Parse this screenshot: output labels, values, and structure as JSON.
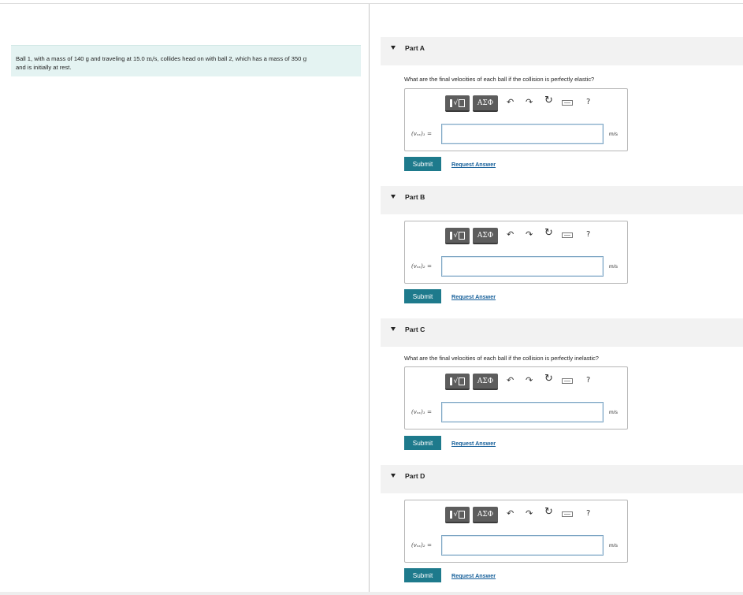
{
  "problem": {
    "text_before_speed": "Ball 1, with a mass of 140 g and traveling at 15.0 ",
    "speed_unit": "m/s",
    "text_after_speed": ", collides head on with ball 2, which has a mass of 350 ",
    "mass_unit": "g",
    "text_line2": "and is initially at rest."
  },
  "parts": [
    {
      "title": "Part A",
      "question": "What are the final velocities of each ball if the collision is perfectly elastic?",
      "variable": "(vₓₓ)₁ =",
      "unit": "m/s",
      "submit": "Submit",
      "request": "Request Answer"
    },
    {
      "title": "Part B",
      "question": "",
      "variable": "(vₓₓ)₂ =",
      "unit": "m/s",
      "submit": "Submit",
      "request": "Request Answer"
    },
    {
      "title": "Part C",
      "question": "What are the final velocities of each ball if the collision is perfectly inelastic?",
      "variable": "(vₓₓ)₁ =",
      "unit": "m/s",
      "submit": "Submit",
      "request": "Request Answer"
    },
    {
      "title": "Part D",
      "question": "",
      "variable": "(vₓₓ)₂ =",
      "unit": "m/s",
      "submit": "Submit",
      "request": "Request Answer"
    }
  ],
  "toolbar": {
    "greek_label": "ΑΣΦ",
    "templates_radical": "√",
    "undo_icon": "undo-icon",
    "redo_icon": "redo-icon",
    "reset_icon": "reset-icon",
    "keyboard_icon": "keyboard-icon",
    "help_label": "?"
  },
  "colors": {
    "problem_bg": "#e4f3f2",
    "submit_bg": "#1e7a8c",
    "link": "#17609a",
    "toolbar_btn": "#5d5d5d"
  }
}
